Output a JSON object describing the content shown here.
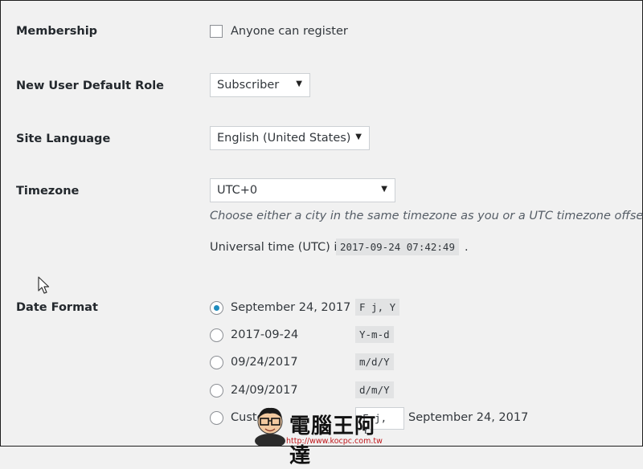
{
  "membership": {
    "label": "Membership",
    "checkbox_label": "Anyone can register",
    "checked": false
  },
  "default_role": {
    "label": "New User Default Role",
    "selected": "Subscriber"
  },
  "site_language": {
    "label": "Site Language",
    "selected": "English (United States)"
  },
  "timezone": {
    "label": "Timezone",
    "selected": "UTC+0",
    "description": "Choose either a city in the same timezone as you or a UTC timezone offset.",
    "utc_prefix": "Universal time (UTC) is",
    "utc_time": "2017-09-24 07:42:49",
    "utc_suffix": "."
  },
  "date_format": {
    "label": "Date Format",
    "options": [
      {
        "label": "September 24, 2017",
        "code": "F j, Y",
        "selected": true
      },
      {
        "label": "2017-09-24",
        "code": "Y-m-d",
        "selected": false
      },
      {
        "label": "09/24/2017",
        "code": "m/d/Y",
        "selected": false
      },
      {
        "label": "24/09/2017",
        "code": "d/m/Y",
        "selected": false
      }
    ],
    "custom": {
      "label": "Custo",
      "input_value": "F j, Y",
      "preview": "September 24, 2017"
    }
  },
  "watermark": {
    "text": "電腦王阿達",
    "url": "http://www.kocpc.com.tw"
  },
  "colors": {
    "radio_selected": "#1e8cbe",
    "background": "#f1f1f1",
    "code_bg": "#e2e3e4"
  }
}
